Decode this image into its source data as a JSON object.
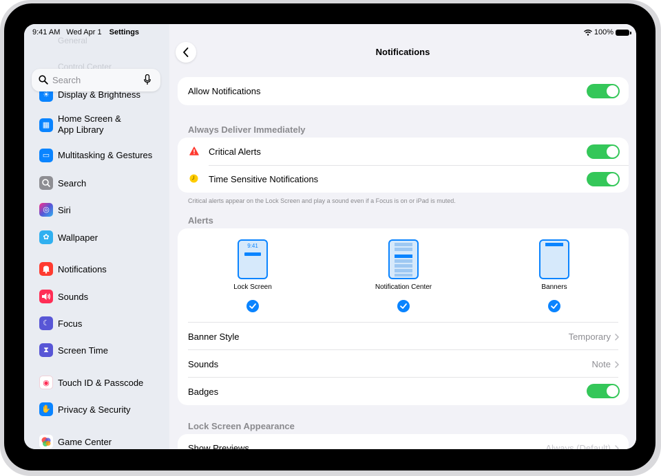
{
  "status_bar": {
    "time": "9:41 AM",
    "date": "Wed Apr 1",
    "battery": "100%"
  },
  "sidebar": {
    "title": "Settings",
    "search_placeholder": "Search",
    "partial_top_labels": [
      "General",
      "Control Center"
    ],
    "items": [
      {
        "label": "Display & Brightness",
        "icon": "sun-icon",
        "color": "#0a84ff"
      },
      {
        "label": "Home Screen &\nApp Library",
        "icon": "home-screen-icon",
        "color": "#0a84ff"
      },
      {
        "label": "Multitasking & Gestures",
        "icon": "multitasking-icon",
        "color": "#0a84ff"
      },
      {
        "label": "Search",
        "icon": "search-icon",
        "color": "#8e8e93"
      },
      {
        "label": "Siri",
        "icon": "siri-icon",
        "color": "#5856d6"
      },
      {
        "label": "Wallpaper",
        "icon": "flower-icon",
        "color": "#30b0f0"
      },
      {
        "label": "Notifications",
        "icon": "bell-icon",
        "color": "#ff3b30"
      },
      {
        "label": "Sounds",
        "icon": "speaker-icon",
        "color": "#ff2d55"
      },
      {
        "label": "Focus",
        "icon": "moon-icon",
        "color": "#5856d6"
      },
      {
        "label": "Screen Time",
        "icon": "hourglass-icon",
        "color": "#5856d6"
      },
      {
        "label": "Touch ID & Passcode",
        "icon": "fingerprint-icon",
        "color": "#ff2d55"
      },
      {
        "label": "Privacy & Security",
        "icon": "hand-icon",
        "color": "#0a84ff"
      },
      {
        "label": "Game Center",
        "icon": "game-center-icon",
        "color": "#ff9500"
      }
    ]
  },
  "detail": {
    "title": "Notifications",
    "allow_notifications": {
      "label": "Allow Notifications",
      "on": true
    },
    "always_deliver": {
      "header": "Always Deliver Immediately",
      "rows": [
        {
          "label": "Critical Alerts",
          "icon": "warning-icon",
          "on": true
        },
        {
          "label": "Time Sensitive Notifications",
          "icon": "clock-icon",
          "on": true
        }
      ],
      "footnote": "Critical alerts appear on the Lock Screen and play a sound even if a Focus is on or iPad is muted."
    },
    "alerts": {
      "header": "Alerts",
      "options": [
        {
          "label": "Lock Screen",
          "checked": true,
          "preview_time": "9:41"
        },
        {
          "label": "Notification Center",
          "checked": true
        },
        {
          "label": "Banners",
          "checked": true
        }
      ],
      "rows": [
        {
          "label": "Banner Style",
          "value": "Temporary"
        },
        {
          "label": "Sounds",
          "value": "Note"
        },
        {
          "label": "Badges",
          "on": true
        }
      ]
    },
    "lock_screen": {
      "header": "Lock Screen Appearance",
      "rows": [
        {
          "label": "Show Previews",
          "value": "Always (Default)"
        }
      ]
    }
  },
  "colors": {
    "accent": "#0a84ff",
    "toggle_on": "#34c759",
    "sidebar_bg": "#e9ecf2",
    "detail_bg": "#f2f2f7"
  }
}
